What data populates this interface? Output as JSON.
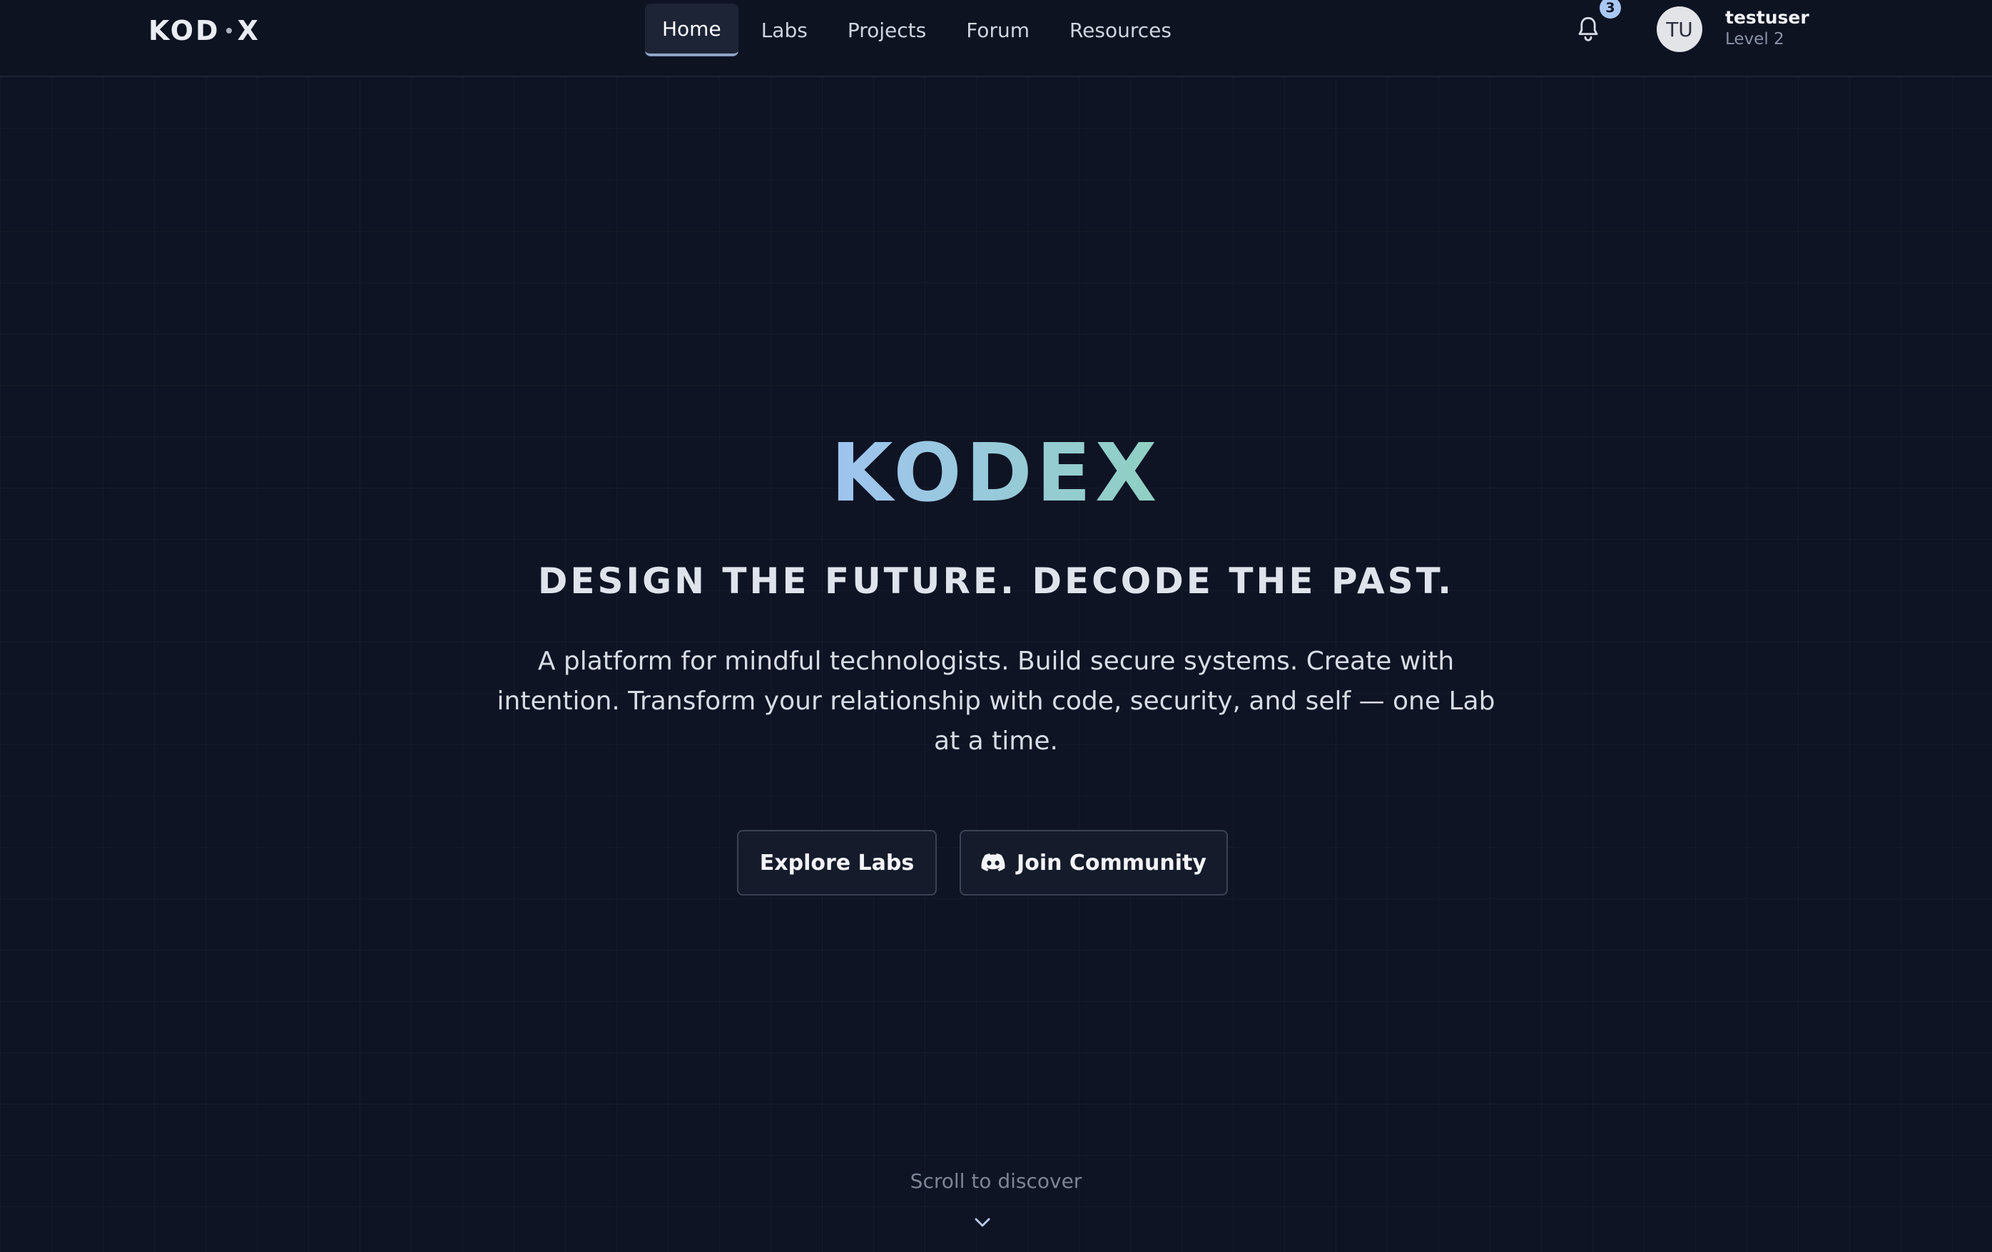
{
  "nav": {
    "brand": {
      "left": "KOD",
      "right": "X"
    },
    "tabs": [
      {
        "label": "Home",
        "active": true
      },
      {
        "label": "Labs",
        "active": false
      },
      {
        "label": "Projects",
        "active": false
      },
      {
        "label": "Forum",
        "active": false
      },
      {
        "label": "Resources",
        "active": false
      }
    ],
    "notifications": {
      "icon": "bell-icon",
      "count": "3"
    },
    "user": {
      "initials": "TU",
      "name": "testuser",
      "level": "Level 2"
    }
  },
  "hero": {
    "logo_text": "KODEX",
    "logo_gradient": [
      "#9fc4f0",
      "#8fd0c2"
    ],
    "tagline": "DESIGN THE FUTURE. DECODE THE PAST.",
    "description": "A platform for mindful technologists. Build secure systems. Create with intention. Transform your relationship with code, security, and self — one Lab at a time.",
    "buttons": {
      "explore": "Explore Labs",
      "community": "Join Community",
      "community_icon": "discord-icon"
    },
    "scroll_hint": "Scroll to discover",
    "scroll_icon": "chevron-down-icon"
  },
  "colors": {
    "background": "#0f1424",
    "accent": "#a8c8f2"
  }
}
